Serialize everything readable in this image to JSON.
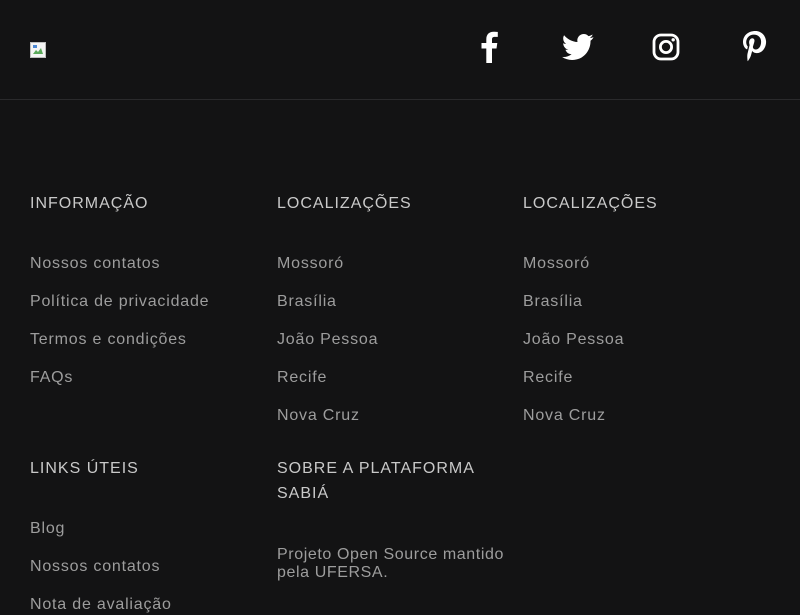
{
  "header": {
    "logo_alt": "Logo",
    "social": [
      {
        "name": "facebook-icon"
      },
      {
        "name": "twitter-icon"
      },
      {
        "name": "instagram-icon"
      },
      {
        "name": "pinterest-icon"
      }
    ]
  },
  "footer": {
    "info": {
      "title": "INFORMAÇÃO",
      "links": [
        "Nossos contatos",
        "Política de privacidade",
        "Termos e condições",
        "FAQs"
      ]
    },
    "locations_1": {
      "title": "LOCALIZAÇÕES",
      "links": [
        "Mossoró",
        "Brasília",
        "João Pessoa",
        "Recife",
        "Nova Cruz"
      ]
    },
    "locations_2": {
      "title": "LOCALIZAÇÕES",
      "links": [
        "Mossoró",
        "Brasília",
        "João Pessoa",
        "Recife",
        "Nova Cruz"
      ]
    },
    "useful_links": {
      "title": "LINKS ÚTEIS",
      "links": [
        "Blog",
        "Nossos contatos",
        "Nota de avaliação"
      ]
    },
    "about": {
      "title_line1": "SOBRE A PLATAFORMA",
      "title_line2": "SABIÁ",
      "text_line1": "Projeto Open Source mantido",
      "text_line2": "pela UFERSA."
    }
  },
  "colors": {
    "background": "#131314",
    "heading": "#c9c9c9",
    "link": "#9d9d9d",
    "icon": "#ffffff"
  }
}
